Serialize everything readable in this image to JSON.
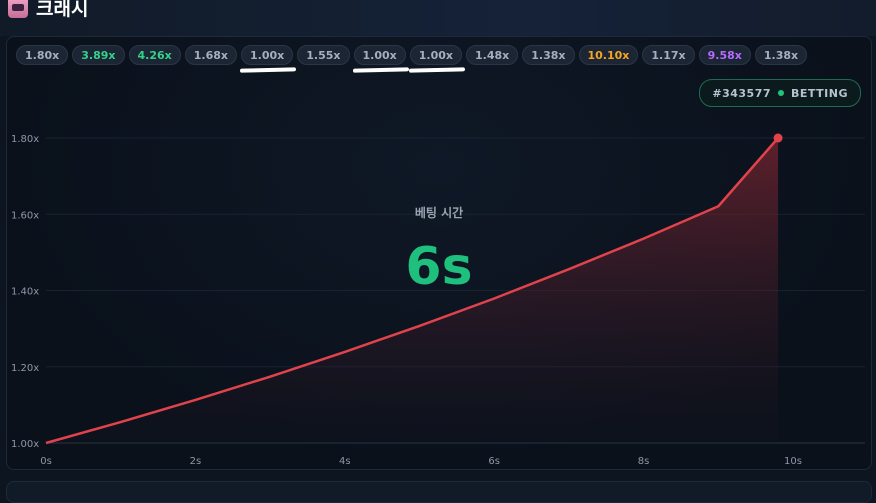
{
  "header": {
    "title": "크래시",
    "icon": "slot-machine-icon"
  },
  "history": [
    {
      "label": "1.80x",
      "color": "#a6afbd",
      "underline": false
    },
    {
      "label": "3.89x",
      "color": "#35d18b",
      "underline": false
    },
    {
      "label": "4.26x",
      "color": "#35d18b",
      "underline": false
    },
    {
      "label": "1.68x",
      "color": "#a6afbd",
      "underline": false
    },
    {
      "label": "1.00x",
      "color": "#a6afbd",
      "underline": true
    },
    {
      "label": "1.55x",
      "color": "#a6afbd",
      "underline": false
    },
    {
      "label": "1.00x",
      "color": "#a6afbd",
      "underline": true
    },
    {
      "label": "1.00x",
      "color": "#a6afbd",
      "underline": true
    },
    {
      "label": "1.48x",
      "color": "#a6afbd",
      "underline": false
    },
    {
      "label": "1.38x",
      "color": "#a6afbd",
      "underline": false
    },
    {
      "label": "10.10x",
      "color": "#f5a623",
      "underline": false
    },
    {
      "label": "1.17x",
      "color": "#a6afbd",
      "underline": false
    },
    {
      "label": "9.58x",
      "color": "#b56bff",
      "underline": false
    },
    {
      "label": "1.38x",
      "color": "#a6afbd",
      "underline": false
    }
  ],
  "round": {
    "id": "#343577",
    "status": "BETTING",
    "status_color": "#22c37a"
  },
  "betting": {
    "label": "베팅 시간",
    "countdown": "6s",
    "color": "#1fc07e"
  },
  "chart_data": {
    "type": "line",
    "title": "",
    "xlabel": "",
    "ylabel": "",
    "x_ticks": [
      "0s",
      "2s",
      "4s",
      "6s",
      "8s",
      "10s"
    ],
    "y_ticks": [
      "1.00x",
      "1.20x",
      "1.40x",
      "1.60x",
      "1.80x"
    ],
    "xlim": [
      0,
      10
    ],
    "ylim": [
      1.0,
      1.8
    ],
    "series": [
      {
        "color": "#e0434b",
        "x": [
          0,
          1,
          2,
          3,
          4,
          5,
          6,
          7,
          8,
          9,
          9.8
        ],
        "y": [
          1.0,
          1.055,
          1.113,
          1.174,
          1.239,
          1.307,
          1.379,
          1.456,
          1.536,
          1.621,
          1.8
        ]
      }
    ],
    "grid": true
  }
}
